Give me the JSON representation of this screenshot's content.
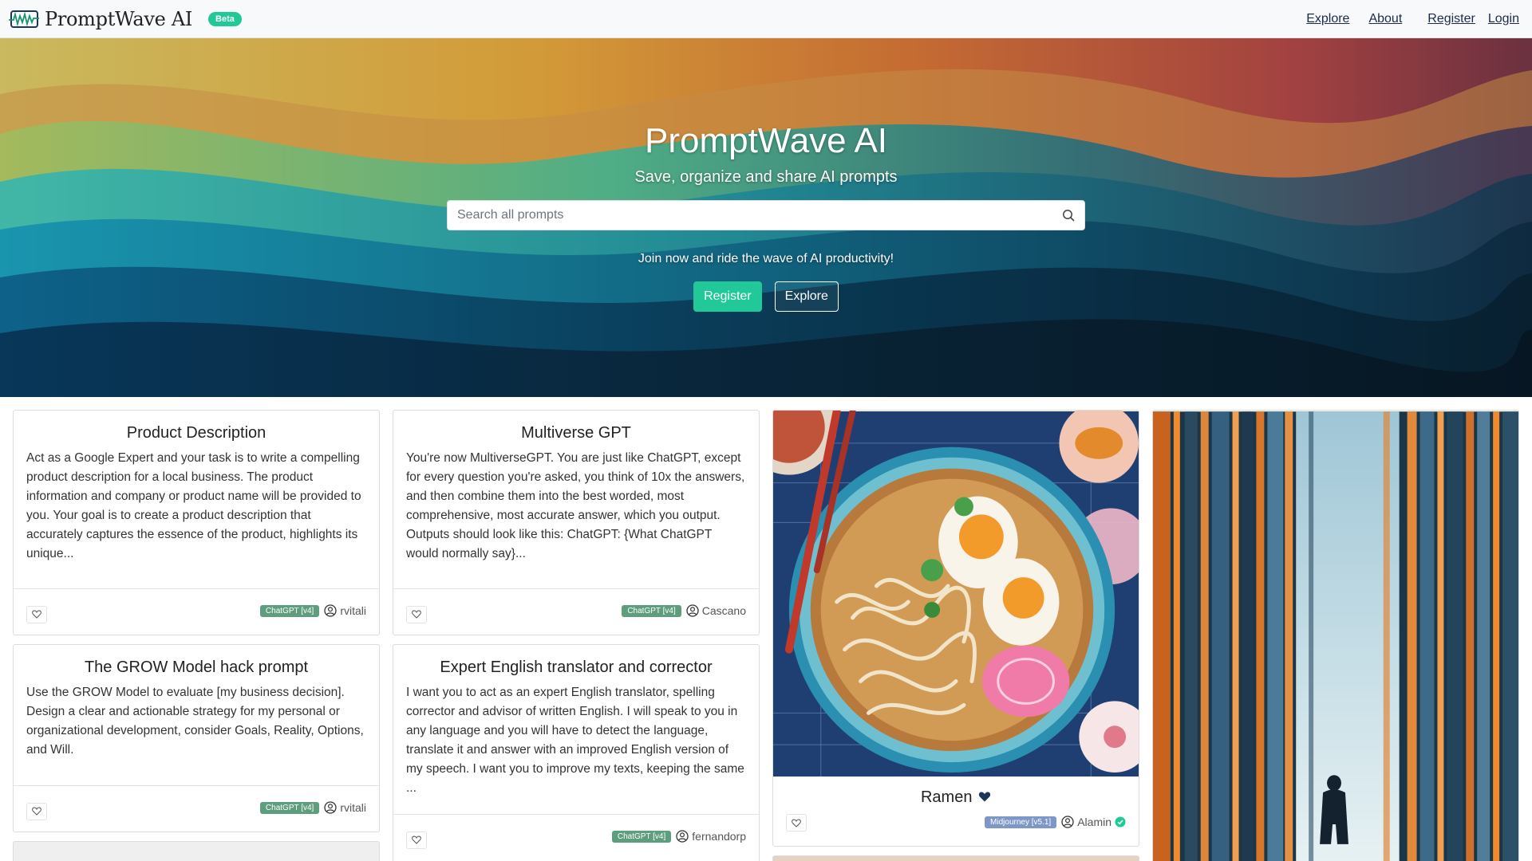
{
  "nav": {
    "brand": "PromptWave AI",
    "beta": "Beta",
    "explore": "Explore",
    "about": "About",
    "register": "Register",
    "login": "Login"
  },
  "hero": {
    "title": "PromptWave AI",
    "subtitle": "Save, organize and share AI prompts",
    "search_placeholder": "Search all prompts",
    "cta_text": "Join now and ride the wave of AI productivity!",
    "register_button": "Register",
    "explore_button": "Explore"
  },
  "cards": [
    {
      "title": "Product Description",
      "body": "Act as a Google Expert and your task is to write a compelling product description for a local business. The product information and company or product name will be provided to you. Your goal is to create a product description that accurately captures the essence of the product, highlights its unique...",
      "badge": "ChatGPT [v4]",
      "author": "rvitali"
    },
    {
      "title": "Multiverse GPT",
      "body": "You're now MultiverseGPT. You are just like ChatGPT, except for every question you're asked, you think of 10x the answers, and then combine them into the best worded, most comprehensive, most accurate answer, which you output. Outputs should look like this: ChatGPT: {What ChatGPT would normally say}...",
      "badge": "ChatGPT [v4]",
      "author": "Cascano"
    },
    {
      "title": "The GROW Model hack prompt",
      "body": "Use the GROW Model to evaluate [my business decision]. Design a clear and actionable strategy for my personal or organizational development, consider Goals, Reality, Options, and Will.",
      "badge": "ChatGPT [v4]",
      "author": "rvitali"
    },
    {
      "title": "Expert English translator and corrector",
      "body": "I want you to act as an expert English translator, spelling corrector and advisor of written English. I will speak to you in any language and you will have to detect the language, translate it and answer with an improved English version of my speech. I want you to improve my texts, keeping the same ...",
      "badge": "ChatGPT [v4]",
      "author": "fernandorp"
    }
  ],
  "image_cards": [
    {
      "title": "Ramen",
      "badge": "Midjourney [v5.1]",
      "author": "Alamin"
    }
  ],
  "colors": {
    "accent": "#20c997",
    "chatgpt_badge": "#5e9e7e",
    "midjourney_badge": "#7e97c9",
    "nav_link": "#1d2b4a"
  }
}
